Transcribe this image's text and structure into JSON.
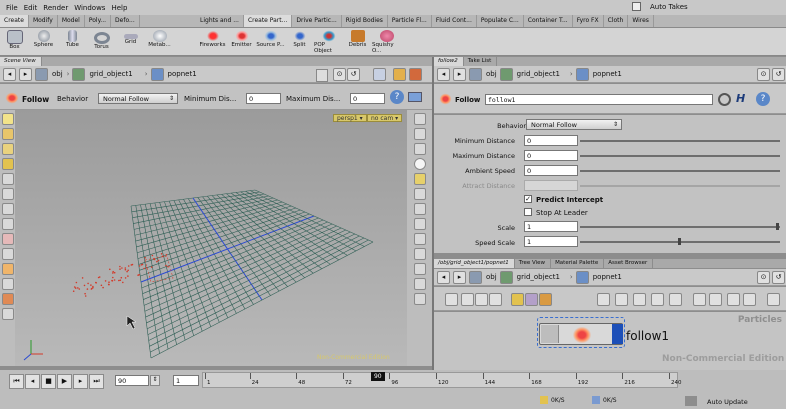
{
  "menubar": {
    "items": [
      "File",
      "Edit",
      "Render",
      "Windows",
      "Help"
    ],
    "auto_takes": "Auto Takes"
  },
  "shelf": {
    "left_tabs": [
      "Create",
      "Modify",
      "Model",
      "Poly...",
      "Defo..."
    ],
    "right_tabs": [
      "Lights and ...",
      "Create Part...",
      "Drive Partic...",
      "Rigid Bodies",
      "Particle Fl...",
      "Fluid Cont...",
      "Populate C...",
      "Container T...",
      "Fyro FX",
      "Cloth",
      "Wires"
    ],
    "left_tools": [
      "Box",
      "Sphere",
      "Tube",
      "Torus",
      "Grid",
      "Metab..."
    ],
    "right_tools": [
      "Fireworks",
      "Emitter",
      "Source P...",
      "Split",
      "POP Object",
      "Debris",
      "Squishy O..."
    ]
  },
  "scene_view": {
    "tab": "Scene View",
    "path": [
      "obj",
      "grid_object1",
      "popnet1"
    ],
    "op_name": "Follow",
    "behavior_label": "Behavior",
    "behavior_value": "Normal Follow",
    "min_dist_label": "Minimum Dis...",
    "min_dist_value": "0",
    "max_dist_label": "Maximum Dis...",
    "max_dist_value": "0",
    "persp": "persp1 ▾",
    "cam": "no cam ▾",
    "watermark": "Non-Commercial Edition"
  },
  "params": {
    "tabs": [
      "follow2",
      "Take List"
    ],
    "path": [
      "obj",
      "grid_object1",
      "popnet1"
    ],
    "op_type": "Follow",
    "op_name": "follow1",
    "behavior_label": "Behavior",
    "behavior_value": "Normal Follow",
    "rows": [
      {
        "label": "Minimum Distance",
        "value": "0"
      },
      {
        "label": "Maximum Distance",
        "value": "0"
      },
      {
        "label": "Ambient Speed",
        "value": "0"
      },
      {
        "label": "Attract Distance",
        "value": ""
      }
    ],
    "predict_intercept": "Predict Intercept",
    "stop_at_leader": "Stop At Leader",
    "scale_label": "Scale",
    "scale_value": "1",
    "speed_scale_label": "Speed Scale",
    "speed_scale_value": "1"
  },
  "network": {
    "tabs": [
      "/obj/grid_object1/popnet1",
      "Tree View",
      "Material Palette",
      "Asset Browser"
    ],
    "path": [
      "obj",
      "grid_object1",
      "popnet1"
    ],
    "context": "Particles",
    "node_name": "follow1",
    "watermark": "Non-Commercial Edition"
  },
  "timeline": {
    "frame": "90",
    "start": "1",
    "ticks": [
      "1",
      "24",
      "48",
      "72",
      "96",
      "120",
      "144",
      "168",
      "192",
      "216",
      "240"
    ],
    "current_marker": "90",
    "status1": "0K/S",
    "status2": "0K/S",
    "auto_update": "Auto Update"
  },
  "colors": {
    "accent_blue": "#1c4fb8",
    "viewport_grid": "#2f5f55",
    "particles": "#d23a2a"
  }
}
